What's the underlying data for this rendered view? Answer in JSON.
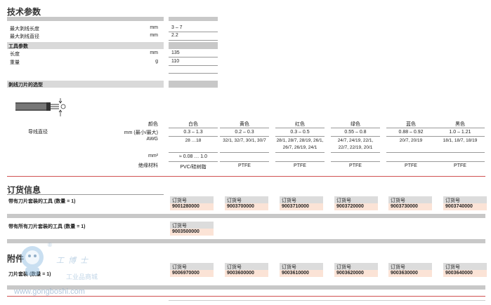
{
  "tech": {
    "title": "技术参数",
    "rows": [
      {
        "label": "最大剥线长度",
        "unit": "mm",
        "value": "3 – 7"
      },
      {
        "label": "最大剥线直径",
        "unit": "mm",
        "value": "2.2"
      }
    ],
    "tool_head": "工具参数",
    "tool_rows": [
      {
        "label": "长度",
        "unit": "mm",
        "value": "135"
      },
      {
        "label": "重量",
        "unit": "g",
        "value": "110"
      }
    ]
  },
  "blade": {
    "title": "剥线刀片的选型",
    "diameter_label": "导线直径",
    "row_labels": [
      "颜色",
      "mm (最小/最大)",
      "AWG",
      "mm²",
      "绝缘材料"
    ],
    "columns": [
      {
        "color": "白色",
        "mm": "0.3 – 1.3",
        "awg": [
          "28 …18",
          ""
        ],
        "mm2": "≈ 0.08 … 1.0",
        "insul": "PVC/硅树脂"
      },
      {
        "color": "黄色",
        "mm": "0.2 – 0.3",
        "awg": [
          "32/1, 32/7, 30/1, 30/7",
          ""
        ],
        "mm2": "",
        "insul": "PTFE"
      },
      {
        "color": "红色",
        "mm": "0.3 – 0.5",
        "awg": [
          "28/1, 28/7, 28/19, 26/1,",
          "26/7, 26/19, 24/1"
        ],
        "mm2": "",
        "insul": "PTFE"
      },
      {
        "color": "绿色",
        "mm": "0.55 – 0.8",
        "awg": [
          "24/7, 24/19, 22/1,",
          "22/7, 22/19, 20/1"
        ],
        "mm2": "",
        "insul": "PTFE"
      },
      {
        "color": "蓝色",
        "mm": "0.88 – 0.92",
        "awg": [
          "20/7, 20/19",
          ""
        ],
        "mm2": "",
        "insul": "PTFE"
      },
      {
        "color": "黑色",
        "mm": "1.0 – 1.21",
        "awg": [
          "18/1, 18/7, 18/19",
          ""
        ],
        "mm2": "",
        "insul": "PTFE"
      }
    ]
  },
  "order": {
    "title": "订货信息",
    "row1_label": "带有刀片套装的工具 (数量 = 1)",
    "row1": [
      {
        "t": "订货号",
        "n": "9001280000"
      },
      {
        "t": "订货号",
        "n": "9003700000"
      },
      {
        "t": "订货号",
        "n": "9003710000"
      },
      {
        "t": "订货号",
        "n": "9003720000"
      },
      {
        "t": "订货号",
        "n": "9003730000"
      },
      {
        "t": "订货号",
        "n": "9003740000"
      }
    ],
    "row2_label": "带有所有刀片套装的工具 (数量 = 1)",
    "row2": [
      {
        "t": "订货号",
        "n": "9003500000"
      }
    ]
  },
  "access": {
    "title": "附件",
    "row_label": "刀片套装 (数量 = 1)",
    "row": [
      {
        "t": "订货号",
        "n": "9006970000"
      },
      {
        "t": "订货号",
        "n": "9003600000"
      },
      {
        "t": "订货号",
        "n": "9003610000"
      },
      {
        "t": "订货号",
        "n": "9003620000"
      },
      {
        "t": "订货号",
        "n": "9003630000"
      },
      {
        "t": "订货号",
        "n": "9003640000"
      }
    ]
  },
  "watermark": {
    "brand": "工博士",
    "sub": "工业品商城",
    "url": "www.gongboshi.com",
    "reg": "®"
  }
}
